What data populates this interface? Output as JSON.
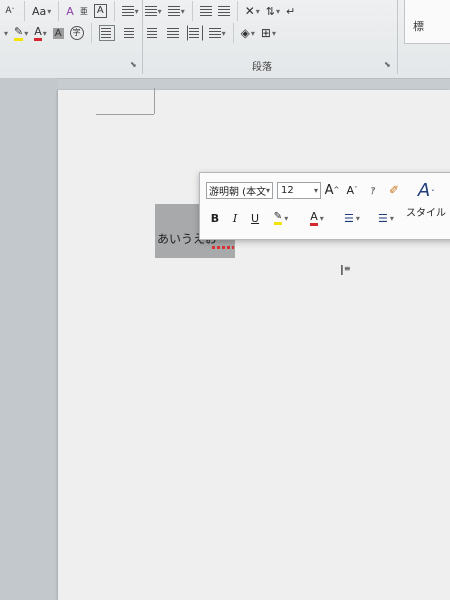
{
  "ribbon": {
    "font_row1": {
      "shrink_font": "A",
      "change_case": "Aa",
      "clear_format": "A",
      "furigana": "亜",
      "char_border": "A"
    },
    "font_row2": {
      "highlight_color": "#f4e300",
      "font_color": "#d9262c",
      "char_shading": "A",
      "enclose_char": "字"
    },
    "paragraph_label": "段落",
    "styles_partial": "標"
  },
  "document": {
    "text": "あいうえお"
  },
  "mini_toolbar": {
    "font_name": "游明朝 (本文",
    "font_size": "12",
    "grow_font": "A",
    "shrink_font": "A",
    "bold": "B",
    "italic": "I",
    "underline": "U",
    "font_color_glyph": "A",
    "styles_label": "スタイル"
  },
  "colors": {
    "highlight": "#f4e300",
    "font_color": "#d9262c",
    "selection": "#a7a9aa"
  }
}
